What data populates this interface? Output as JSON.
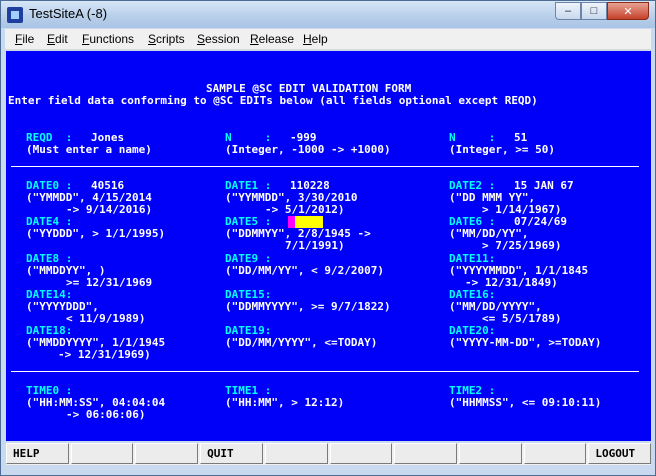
{
  "window": {
    "title": "TestSiteA (-8)",
    "buttons": {
      "minimize": "–",
      "maximize": "□",
      "close": "✕"
    }
  },
  "menu": [
    "File",
    "Edit",
    "Functions",
    "Scripts",
    "Session",
    "Release",
    "Help"
  ],
  "form": {
    "title": "SAMPLE @SC EDIT VALIDATION FORM",
    "subtitle": "Enter field data conforming to @SC EDITs below (all fields optional except REQD)",
    "fields": {
      "reqd": {
        "label": "REQD  :",
        "value": "Jones",
        "hint": "(Must enter a name)"
      },
      "n1": {
        "label": "N     :",
        "value": "-999",
        "hint": "(Integer, -1000 -> +1000)"
      },
      "n2": {
        "label": "N     :",
        "value": "51",
        "hint": "(Integer, >= 50)"
      },
      "date0": {
        "label": "DATE0 :",
        "value": "40516",
        "hint1": "(\"YMMDD\", 4/15/2014",
        "hint2": "-> 9/14/2016)"
      },
      "date1": {
        "label": "DATE1 :",
        "value": "110228",
        "hint1": "(\"YYMMDD\", 3/30/2010",
        "hint2": "-> 5/1/2012)"
      },
      "date2": {
        "label": "DATE2 :",
        "value": "15 JAN 67",
        "hint1": "(\"DD MMM YY\",",
        "hint2": "> 1/14/1967)"
      },
      "date4": {
        "label": "DATE4 :",
        "value": "",
        "hint1": "(\"YYDDD\", > 1/1/1995)"
      },
      "date5": {
        "label": "DATE5 :",
        "value": "",
        "hint1": "(\"DDMMYY\", 2/8/1945 ->",
        "hint2": "7/1/1991)"
      },
      "date6": {
        "label": "DATE6 :",
        "value": "07/24/69",
        "hint1": "(\"MM/DD/YY\",",
        "hint2": "> 7/25/1969)"
      },
      "date8": {
        "label": "DATE8 :",
        "value": "",
        "hint1": "(\"MMDDYY\", )",
        "hint2": ">= 12/31/1969"
      },
      "date9": {
        "label": "DATE9 :",
        "value": "",
        "hint1": "(\"DD/MM/YY\", < 9/2/2007)"
      },
      "date11": {
        "label": "DATE11:",
        "value": "",
        "hint1": "(\"YYYYMMDD\", 1/1/1845",
        "hint2": "-> 12/31/1849)"
      },
      "date14": {
        "label": "DATE14:",
        "value": "",
        "hint1": "(\"YYYYDDD\",",
        "hint2": "< 11/9/1989)"
      },
      "date15": {
        "label": "DATE15:",
        "value": "",
        "hint1": "(\"DDMMYYYY\", >= 9/7/1822)"
      },
      "date16": {
        "label": "DATE16:",
        "value": "",
        "hint1": "(\"MM/DD/YYYY\",",
        "hint2": "<= 5/5/1789)"
      },
      "date18": {
        "label": "DATE18:",
        "value": "",
        "hint1": "(\"MMDDYYYY\", 1/1/1945",
        "hint2": "-> 12/31/1969)"
      },
      "date19": {
        "label": "DATE19:",
        "value": "",
        "hint1": "(\"DD/MM/YYYY\", <=TODAY)"
      },
      "date20": {
        "label": "DATE20:",
        "value": "",
        "hint1": "(\"YYYY-MM-DD\", >=TODAY)"
      },
      "time0": {
        "label": "TIME0 :",
        "value": "",
        "hint1": "(\"HH:MM:SS\", 04:04:04",
        "hint2": "-> 06:06:06)"
      },
      "time1": {
        "label": "TIME1 :",
        "value": "",
        "hint1": "(\"HH:MM\", > 12:12)"
      },
      "time2": {
        "label": "TIME2 :",
        "value": "",
        "hint1": "(\"HHMMSS\", <= 09:10:11)"
      }
    }
  },
  "fkeys": [
    "HELP",
    "",
    "",
    "QUIT",
    "",
    "",
    "",
    "",
    "",
    "LOGOUT"
  ],
  "colors": {
    "screen": "#0000f8",
    "label": "#00ffff",
    "text": "#ffffff",
    "cursor": "#ff00ff",
    "input_highlight": "#ffff00"
  }
}
